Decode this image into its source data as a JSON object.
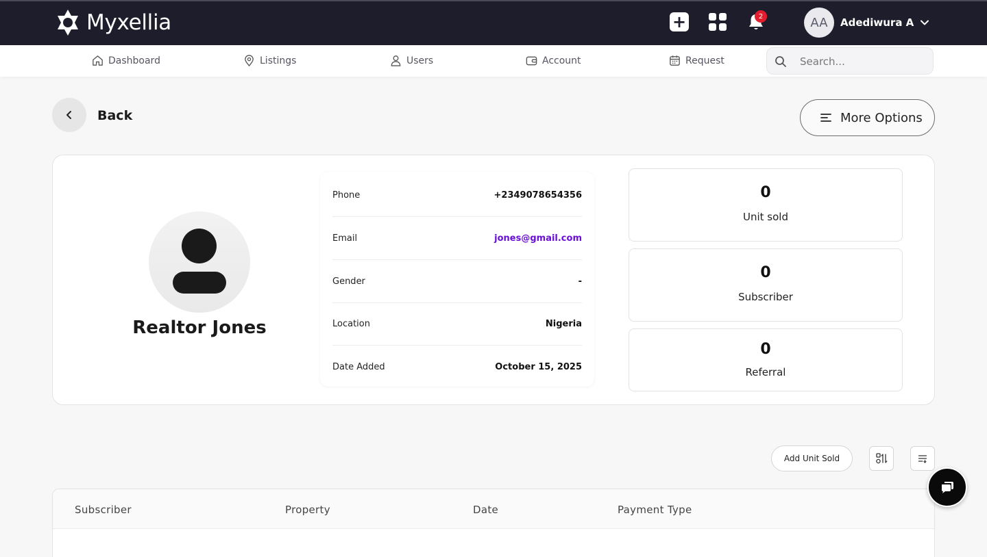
{
  "app": {
    "name": "Myxellia"
  },
  "topbar": {
    "notification_count": "2",
    "user_initials": "AA",
    "user_name": "Adediwura A"
  },
  "nav": {
    "items": [
      {
        "label": "Dashboard",
        "icon": "home-icon"
      },
      {
        "label": "Listings",
        "icon": "map-pin-icon"
      },
      {
        "label": "Users",
        "icon": "user-icon"
      },
      {
        "label": "Account",
        "icon": "wallet-icon"
      },
      {
        "label": "Request",
        "icon": "calendar-icon"
      }
    ],
    "search_placeholder": "Search..."
  },
  "page": {
    "back_label": "Back",
    "more_options_label": "More Options"
  },
  "profile": {
    "name": "Realtor Jones",
    "fields": [
      {
        "label": "Phone",
        "value": "+2349078654356"
      },
      {
        "label": "Email",
        "value": "jones@gmail.com"
      },
      {
        "label": "Gender",
        "value": "-"
      },
      {
        "label": "Location",
        "value": "Nigeria"
      },
      {
        "label": "Date Added",
        "value": "October 15, 2025"
      }
    ]
  },
  "stats": [
    {
      "value": "0",
      "label": "Unit sold"
    },
    {
      "value": "0",
      "label": "Subscriber"
    },
    {
      "value": "0",
      "label": "Referral"
    }
  ],
  "table": {
    "add_button_label": "Add Unit Sold",
    "columns": [
      "Subscriber",
      "Property",
      "Date",
      "Payment Type"
    ]
  },
  "colors": {
    "topbar_bg": "#1e1d2b",
    "email_link": "#6a0fd8",
    "badge": "#e11d2e"
  }
}
